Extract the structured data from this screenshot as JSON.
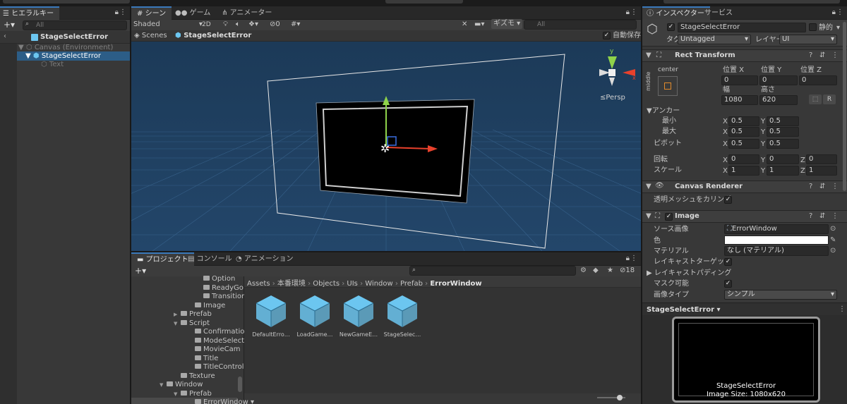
{
  "hierarchy": {
    "tab_label": "ヒエラルキー",
    "search_placeholder": "All",
    "scene_title": "StageSelectError",
    "items": [
      {
        "label": "Canvas (Environment)"
      },
      {
        "label": "StageSelectError"
      },
      {
        "label": "Text"
      }
    ]
  },
  "scene_view": {
    "tabs": [
      "シーン",
      "ゲーム",
      "アニメーター"
    ],
    "shading_mode": "Shaded",
    "mode_2d": "2D",
    "hidden_count": "0",
    "gizmos_label": "ギズモ",
    "search_placeholder": "All",
    "breadcrumb": [
      "Scenes",
      "StageSelectError"
    ],
    "auto_save_label": "自動保存",
    "axis_labels": {
      "x": "x",
      "y": "y"
    },
    "persp_label": "≤Persp"
  },
  "project": {
    "tabs": [
      "プロジェクト",
      "コンソール",
      "アニメーション"
    ],
    "add_label": "+",
    "hidden_count": "18",
    "tree": [
      {
        "label": "Option",
        "level": 4,
        "arrow": ""
      },
      {
        "label": "ReadyGo",
        "level": 4,
        "arrow": ""
      },
      {
        "label": "Transition",
        "level": 4,
        "arrow": ""
      },
      {
        "label": "Image",
        "level": 3,
        "arrow": ""
      },
      {
        "label": "Prefab",
        "level": 2,
        "arrow": "▶"
      },
      {
        "label": "Script",
        "level": 2,
        "arrow": "▼"
      },
      {
        "label": "Confirmation",
        "level": 3,
        "arrow": ""
      },
      {
        "label": "ModeSelect",
        "level": 3,
        "arrow": ""
      },
      {
        "label": "MovieCam",
        "level": 3,
        "arrow": ""
      },
      {
        "label": "Title",
        "level": 3,
        "arrow": ""
      },
      {
        "label": "TitleControl",
        "level": 3,
        "arrow": ""
      },
      {
        "label": "Texture",
        "level": 2,
        "arrow": ""
      },
      {
        "label": "Window",
        "level": 1,
        "arrow": "▼"
      },
      {
        "label": "Prefab",
        "level": 2,
        "arrow": "▼"
      },
      {
        "label": "ErrorWindow",
        "level": 3,
        "arrow": ""
      }
    ],
    "path": [
      "Assets",
      "本番環境",
      "Objects",
      "UIs",
      "Window",
      "Prefab",
      "ErrorWindow"
    ],
    "assets": [
      {
        "label": "DefaultErro…"
      },
      {
        "label": "LoadGame…"
      },
      {
        "label": "NewGameE…"
      },
      {
        "label": "StageSelec…"
      }
    ]
  },
  "inspector": {
    "tabs": [
      "インスペクター",
      "サービス"
    ],
    "object_name": "StageSelectError",
    "static_label": "静的",
    "tag_label": "タグ",
    "tag_value": "Untagged",
    "layer_label": "レイヤー",
    "layer_value": "UI",
    "rect_transform": {
      "title": "Rect Transform",
      "anchor_h": "center",
      "anchor_v": "middle",
      "pos_x_label": "位置 X",
      "pos_y_label": "位置 Y",
      "pos_z_label": "位置 Z",
      "pos_x": "0",
      "pos_y": "0",
      "pos_z": "0",
      "width_label": "幅",
      "height_label": "高さ",
      "width": "1080",
      "height": "620",
      "r_button": "R",
      "anchors_label": "アンカー",
      "min_label": "最小",
      "max_label": "最大",
      "pivot_label": "ピボット",
      "min_x": "0.5",
      "min_y": "0.5",
      "max_x": "0.5",
      "max_y": "0.5",
      "pivot_x": "0.5",
      "pivot_y": "0.5",
      "rotation_label": "回転",
      "rot_x": "0",
      "rot_y": "0",
      "rot_z": "0",
      "scale_label": "スケール",
      "scale_x": "1",
      "scale_y": "1",
      "scale_z": "1",
      "axis_x": "X",
      "axis_y": "Y",
      "axis_z": "Z"
    },
    "canvas_renderer": {
      "title": "Canvas Renderer",
      "cull_label": "透明メッシュをカリング"
    },
    "image": {
      "title": "Image",
      "source_label": "ソース画像",
      "source_value": "ErrorWindow",
      "color_label": "色",
      "material_label": "マテリアル",
      "material_value": "なし (マテリアル)",
      "raycast_target_label": "レイキャストターゲット",
      "raycast_padding_label": "レイキャストパディング",
      "maskable_label": "マスク可能",
      "image_type_label": "画像タイプ",
      "image_type_value": "シンプル"
    },
    "preview": {
      "title": "StageSelectError",
      "caption_name": "StageSelectError",
      "caption_size": "Image Size: 1080x620"
    }
  },
  "colors": {
    "selection": "#2c5d87",
    "accent": "#3a79bb",
    "scene_bg": "#1f3e5d",
    "x_axis": "#e8412c",
    "y_axis": "#8fd34a",
    "z_axis": "#3b6ee0",
    "cube_icon": "#6cc6f0"
  }
}
